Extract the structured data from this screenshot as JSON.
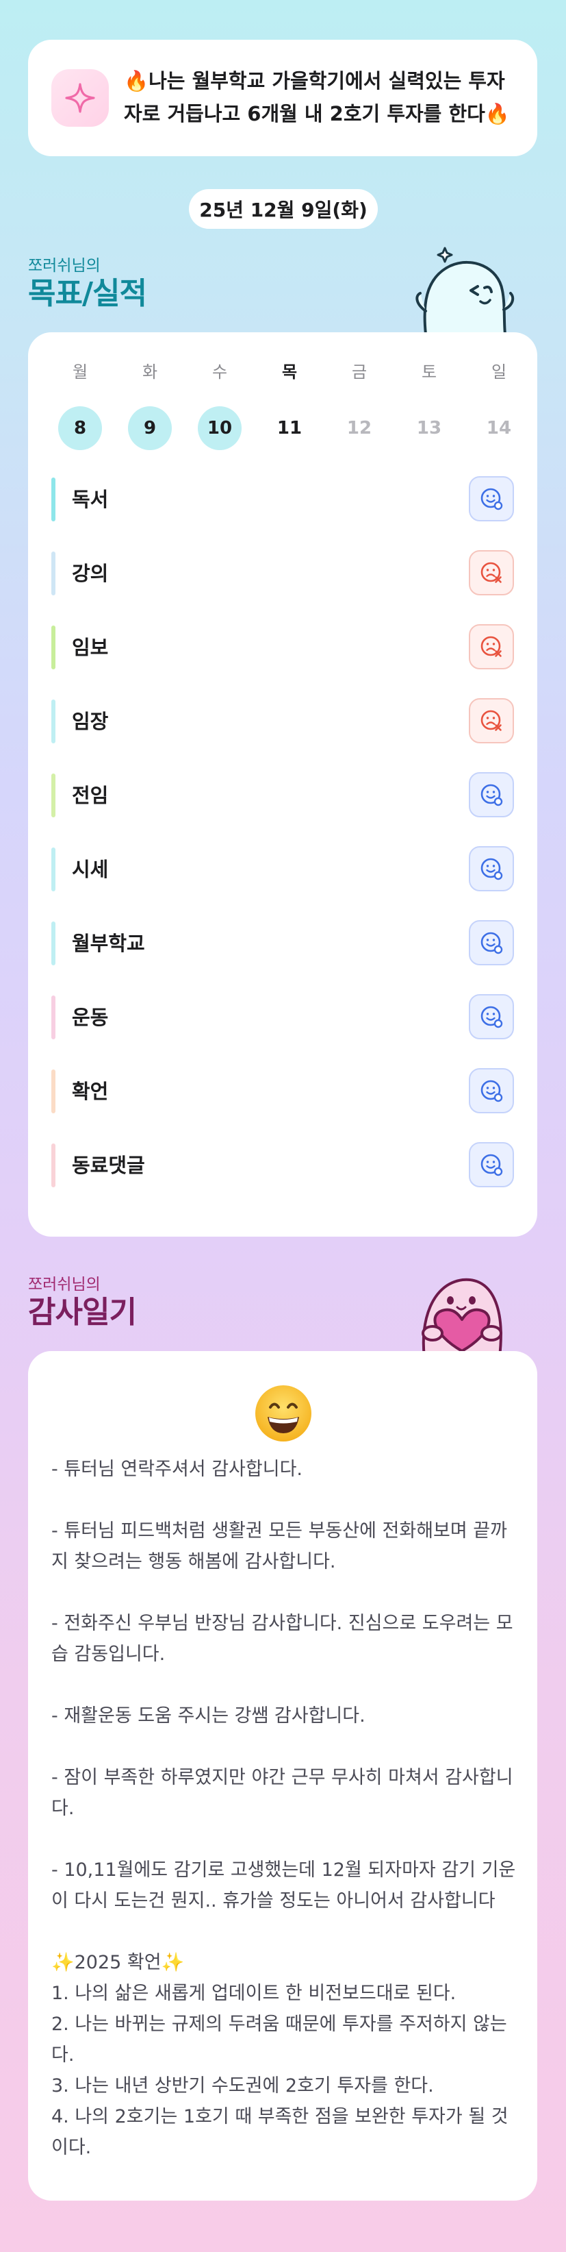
{
  "goal": {
    "text": "🔥나는 월부학교 가을학기에서 실력있는 투자자로 거듭나고 6개월 내 2호기 투자를 한다🔥",
    "icon": "sparkle-icon"
  },
  "date": "25년 12월 9일(화)",
  "goals_section": {
    "subtitle": "쪼러쉬님의",
    "title": "목표/실적",
    "title_color": "#10899a"
  },
  "week": {
    "weekdays": [
      "월",
      "화",
      "수",
      "목",
      "금",
      "토",
      "일"
    ],
    "days": [
      "8",
      "9",
      "10",
      "11",
      "12",
      "13",
      "14"
    ]
  },
  "tasks": [
    {
      "label": "독서",
      "status": "done",
      "color": "#8ee6ea"
    },
    {
      "label": "강의",
      "status": "missed",
      "color": "#cfe6f5"
    },
    {
      "label": "임보",
      "status": "missed",
      "color": "#c8ee9b"
    },
    {
      "label": "임장",
      "status": "missed",
      "color": "#bfeff3"
    },
    {
      "label": "전임",
      "status": "done",
      "color": "#d4f0a8"
    },
    {
      "label": "시세",
      "status": "done",
      "color": "#bfeff3"
    },
    {
      "label": "월부학교",
      "status": "done",
      "color": "#bfeff3"
    },
    {
      "label": "운동",
      "status": "done",
      "color": "#f7cfe2"
    },
    {
      "label": "확언",
      "status": "done",
      "color": "#fbdcc6"
    },
    {
      "label": "동료댓글",
      "status": "done",
      "color": "#f9d3d8"
    }
  ],
  "gratitude_section": {
    "subtitle": "쪼러쉬님의",
    "title": "감사일기",
    "title_color": "#7b1f5e",
    "subtitle_color": "#a0296f"
  },
  "gratitude": {
    "emoji": "grinning-face-icon",
    "body": "- 튜터님 연락주셔서 감사합니다.\n\n- 튜터님 피드백처럼 생활권 모든 부동산에 전화해보며 끝까지 찾으려는 행동 해봄에 감사합니다.\n\n- 전화주신 우부님 반장님 감사합니다. 진심으로 도우려는 모습 감동입니다.\n\n- 재활운동 도움 주시는 강쌤 감사합니다.\n\n- 잠이 부족한 하루였지만 야간 근무 무사히 마쳐서 감사합니다.\n\n- 10,11월에도 감기로 고생했는데 12월 되자마자 감기 기운이 다시 도는건 뭔지.. 휴가쓸 정도는 아니어서 감사합니다\n\n✨2025 확언✨\n1. 나의 삶은 새롭게 업데이트 한 비전보드대로 된다.\n2. 나는 바뀌는 규제의 두려움 때문에 투자를 주저하지 않는다.\n3. 나는 내년 상반기 수도권에 2호기 투자를 한다.\n4. 나의 2호기는 1호기 때 부족한 점을 보완한 투자가 될 것이다."
  }
}
